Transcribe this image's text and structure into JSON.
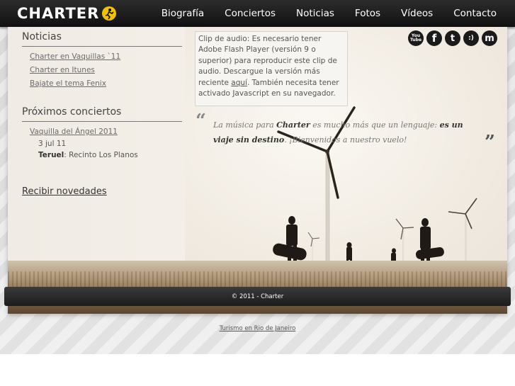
{
  "brand": {
    "name": "CHARTER"
  },
  "nav": {
    "items": [
      "Biografía",
      "Conciertos",
      "Noticias",
      "Fotos",
      "Vídeos",
      "Contacto"
    ]
  },
  "sidebar": {
    "news_title": "Noticias",
    "news_links": [
      "Charter en Vaquillas `11",
      "Charter en Itunes",
      "Bajate el tema Fenix"
    ],
    "concerts_title": "Próximos conciertos",
    "concert": {
      "name": "Vaquilla del Ángel 2011",
      "date": "3 jul 11",
      "city": "Teruel",
      "venue": ": Recinto Los Planos"
    },
    "subscribe": "Recibir novedades"
  },
  "audio": {
    "text_before": "Clip de audio: Es necesario tener Adobe Flash Player (versión 9 o superior) para reproducir este clip de audio. Descargue la versión más reciente ",
    "link": "aquí",
    "text_after": ". También necesita tener activado Javascript en su navegador."
  },
  "social": {
    "icons": [
      {
        "name": "youtube-icon",
        "glyph": "You Tube"
      },
      {
        "name": "facebook-icon",
        "glyph": "f"
      },
      {
        "name": "twitter-icon",
        "glyph": "t"
      },
      {
        "name": "tuenti-icon",
        "glyph": ":)"
      },
      {
        "name": "myspace-icon",
        "glyph": "m"
      }
    ]
  },
  "quote": {
    "part1": "La música para ",
    "bold1": "Charter",
    "part2": " es mucho más que un lenguaje: ",
    "bold2": "es un viaje sin destino",
    "part3": ". ¡Bienvenidos a nuestro vuelo!",
    "open_mark": "“",
    "close_mark": "”"
  },
  "footer": {
    "copyright": "© 2011 - Charter",
    "link": "Turismo en Rio de Janeiro"
  }
}
